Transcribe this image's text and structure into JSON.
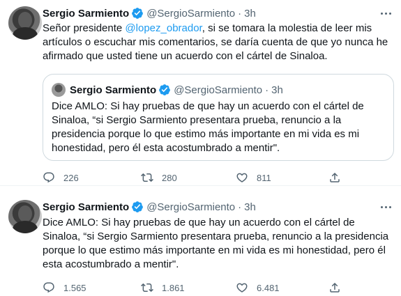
{
  "tweets": [
    {
      "author_name": "Sergio Sarmiento",
      "handle": "@SergioSarmiento",
      "separator": "·",
      "time": "3h",
      "text_before": "Señor presidente ",
      "mention": "@lopez_obrador",
      "text_after": ", si se tomara la molestia de leer mis artículos o escuchar mis comentarios, se daría cuenta de que yo nunca he afirmado que usted tiene un acuerdo con el cártel de Sinaloa.",
      "quote": {
        "author_name": "Sergio Sarmiento",
        "handle": "@SergioSarmiento",
        "separator": "·",
        "time": "3h",
        "text": "Dice AMLO: Si hay pruebas de que hay un acuerdo con el cártel de Sinaloa, “si Sergio Sarmiento  presentara prueba, renuncio a la presidencia porque lo que estimo más importante en mi vida es mi honestidad, pero él esta acostumbrado a mentir\"."
      },
      "replies": "226",
      "retweets": "280",
      "likes": "811"
    },
    {
      "author_name": "Sergio Sarmiento",
      "handle": "@SergioSarmiento",
      "separator": "·",
      "time": "3h",
      "text": "Dice AMLO: Si hay pruebas de que hay un acuerdo con el cártel de Sinaloa, “si Sergio Sarmiento  presentara prueba, renuncio a la presidencia porque lo que estimo más importante en mi vida es mi honestidad, pero él esta acostumbrado a mentir\".",
      "replies": "1.565",
      "retweets": "1.861",
      "likes": "6.481"
    }
  ],
  "icons": {
    "verified": "verified-badge-icon",
    "more": "more-options-icon",
    "reply": "reply-icon",
    "retweet": "retweet-icon",
    "like": "like-icon",
    "share": "share-icon"
  },
  "colors": {
    "link": "#1d9bf0",
    "verified": "#1d9bf0",
    "secondary_text": "#536471",
    "border": "#cfd9de"
  }
}
